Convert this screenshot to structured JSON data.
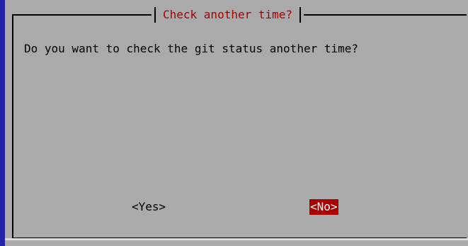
{
  "dialog": {
    "title": "Check another time?",
    "message": "Do you want to check the git status another time?"
  },
  "buttons": {
    "yes_label": "<Yes>",
    "no_label": "<No>"
  },
  "colors": {
    "background": "#aaaaaa",
    "title_text": "#aa0000",
    "focused_button_bg": "#aa0000",
    "focused_button_text": "#ffffff",
    "screen_backdrop": "#2424a8"
  }
}
